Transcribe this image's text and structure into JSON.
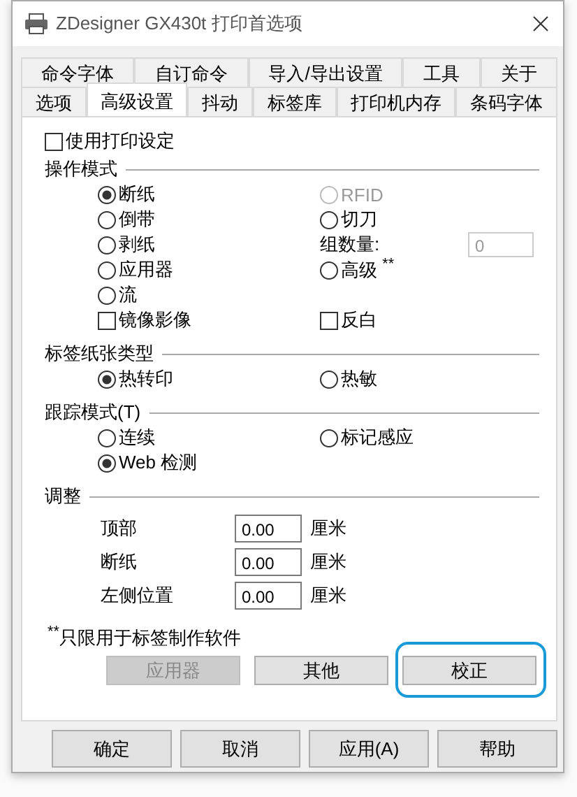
{
  "window": {
    "title": "ZDesigner GX430t 打印首选项"
  },
  "tab_rows": [
    [
      {
        "label": "命令字体",
        "selected": false
      },
      {
        "label": "自订命令",
        "selected": false
      },
      {
        "label": "导入/导出设置",
        "selected": false
      },
      {
        "label": "工具",
        "selected": false
      },
      {
        "label": "关于",
        "selected": false
      }
    ],
    [
      {
        "label": "选项",
        "selected": false
      },
      {
        "label": "高级设置",
        "selected": true
      },
      {
        "label": "抖动",
        "selected": false
      },
      {
        "label": "标签库",
        "selected": false
      },
      {
        "label": "打印机内存",
        "selected": false
      },
      {
        "label": "条码字体",
        "selected": false
      }
    ]
  ],
  "use_print_settings": {
    "label": "使用打印设定",
    "checked": false
  },
  "sections": [
    {
      "title": "操作模式",
      "left": [
        {
          "kind": "radio",
          "label": "断纸",
          "selected": true,
          "disabled": false
        },
        {
          "kind": "radio",
          "label": "倒带",
          "selected": false,
          "disabled": false
        },
        {
          "kind": "radio",
          "label": "剥纸",
          "selected": false,
          "disabled": false
        },
        {
          "kind": "radio",
          "label": "应用器",
          "selected": false,
          "disabled": false
        },
        {
          "kind": "radio",
          "label": "流",
          "selected": false,
          "disabled": false
        }
      ],
      "right": [
        {
          "kind": "radio",
          "label": "RFID",
          "selected": false,
          "disabled": true
        },
        {
          "kind": "radio",
          "label": "切刀",
          "selected": false,
          "disabled": false
        },
        {
          "kind": "field",
          "label": "组数量:",
          "value": "0",
          "disabled": true
        },
        {
          "kind": "radio",
          "label": "高级 $^{**}$",
          "selected": false,
          "disabled": false
        }
      ],
      "checkboxes": [
        {
          "label": "镜像影像",
          "checked": false
        },
        {
          "label": "反白",
          "checked": false
        }
      ]
    },
    {
      "title": "标签纸张类型",
      "left": [
        {
          "kind": "radio",
          "label": "热转印",
          "selected": true,
          "disabled": false
        }
      ],
      "right": [
        {
          "kind": "radio",
          "label": "热敏",
          "selected": false,
          "disabled": false
        }
      ]
    },
    {
      "title": "跟踪模式(T)",
      "left": [
        {
          "kind": "radio",
          "label": "连续",
          "selected": false,
          "disabled": false
        },
        {
          "kind": "radio",
          "label": "Web 检测",
          "selected": true,
          "disabled": false
        }
      ],
      "right": [
        {
          "kind": "radio",
          "label": "标记感应",
          "selected": false,
          "disabled": false
        }
      ]
    }
  ],
  "adjust": {
    "title": "调整",
    "rows": [
      {
        "label": "顶部",
        "value": "0.00",
        "unit": "厘米"
      },
      {
        "label": "断纸",
        "value": "0.00",
        "unit": "厘米"
      },
      {
        "label": "左侧位置",
        "value": "0.00",
        "unit": "厘米"
      }
    ]
  },
  "footnote": "$^{**}$只限用于标签制作软件",
  "panel_buttons": [
    {
      "label": "应用器",
      "disabled": true,
      "highlighted": false
    },
    {
      "label": "其他",
      "disabled": false,
      "highlighted": false
    },
    {
      "label": "校正",
      "disabled": false,
      "highlighted": true
    }
  ],
  "dialog_buttons": [
    "确定",
    "取消",
    "应用(A)",
    "帮助"
  ]
}
